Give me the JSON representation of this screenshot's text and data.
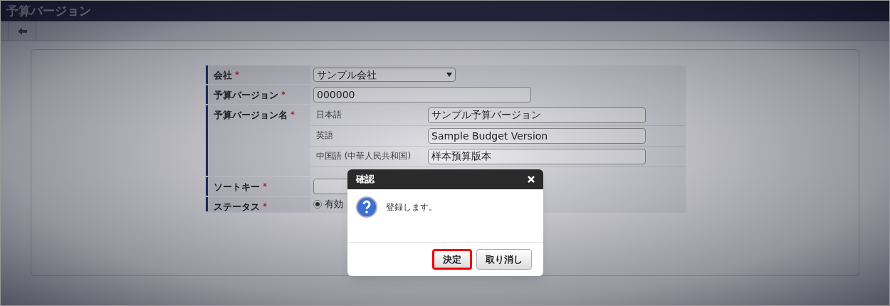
{
  "window": {
    "title": "予算バージョン"
  },
  "form": {
    "fields": [
      {
        "kind": "select",
        "label": "会社",
        "required_mark": "*",
        "value": "サンプル会社"
      },
      {
        "kind": "text",
        "label": "予算バージョン",
        "required_mark": "*",
        "value": "000000"
      },
      {
        "kind": "multilang",
        "label": "予算バージョン名",
        "required_mark": "*",
        "entries": [
          {
            "language": "日本語",
            "value": "サンプル予算バージョン"
          },
          {
            "language": "英語",
            "value": "Sample Budget Version"
          },
          {
            "language": "中国語 (中華人民共和国)",
            "value": "样本预算版本"
          }
        ]
      },
      {
        "kind": "text",
        "label": "ソートキー",
        "required_mark": "*"
      },
      {
        "kind": "radio",
        "label": "ステータス",
        "required_mark": "*",
        "options": [
          {
            "label": "有効",
            "selected": true
          }
        ]
      }
    ]
  },
  "dialog": {
    "title": "確認",
    "message": "登録します。",
    "buttons": [
      {
        "label": "決定",
        "highlighted": true
      },
      {
        "label": "取り消し",
        "highlighted": false
      }
    ]
  }
}
